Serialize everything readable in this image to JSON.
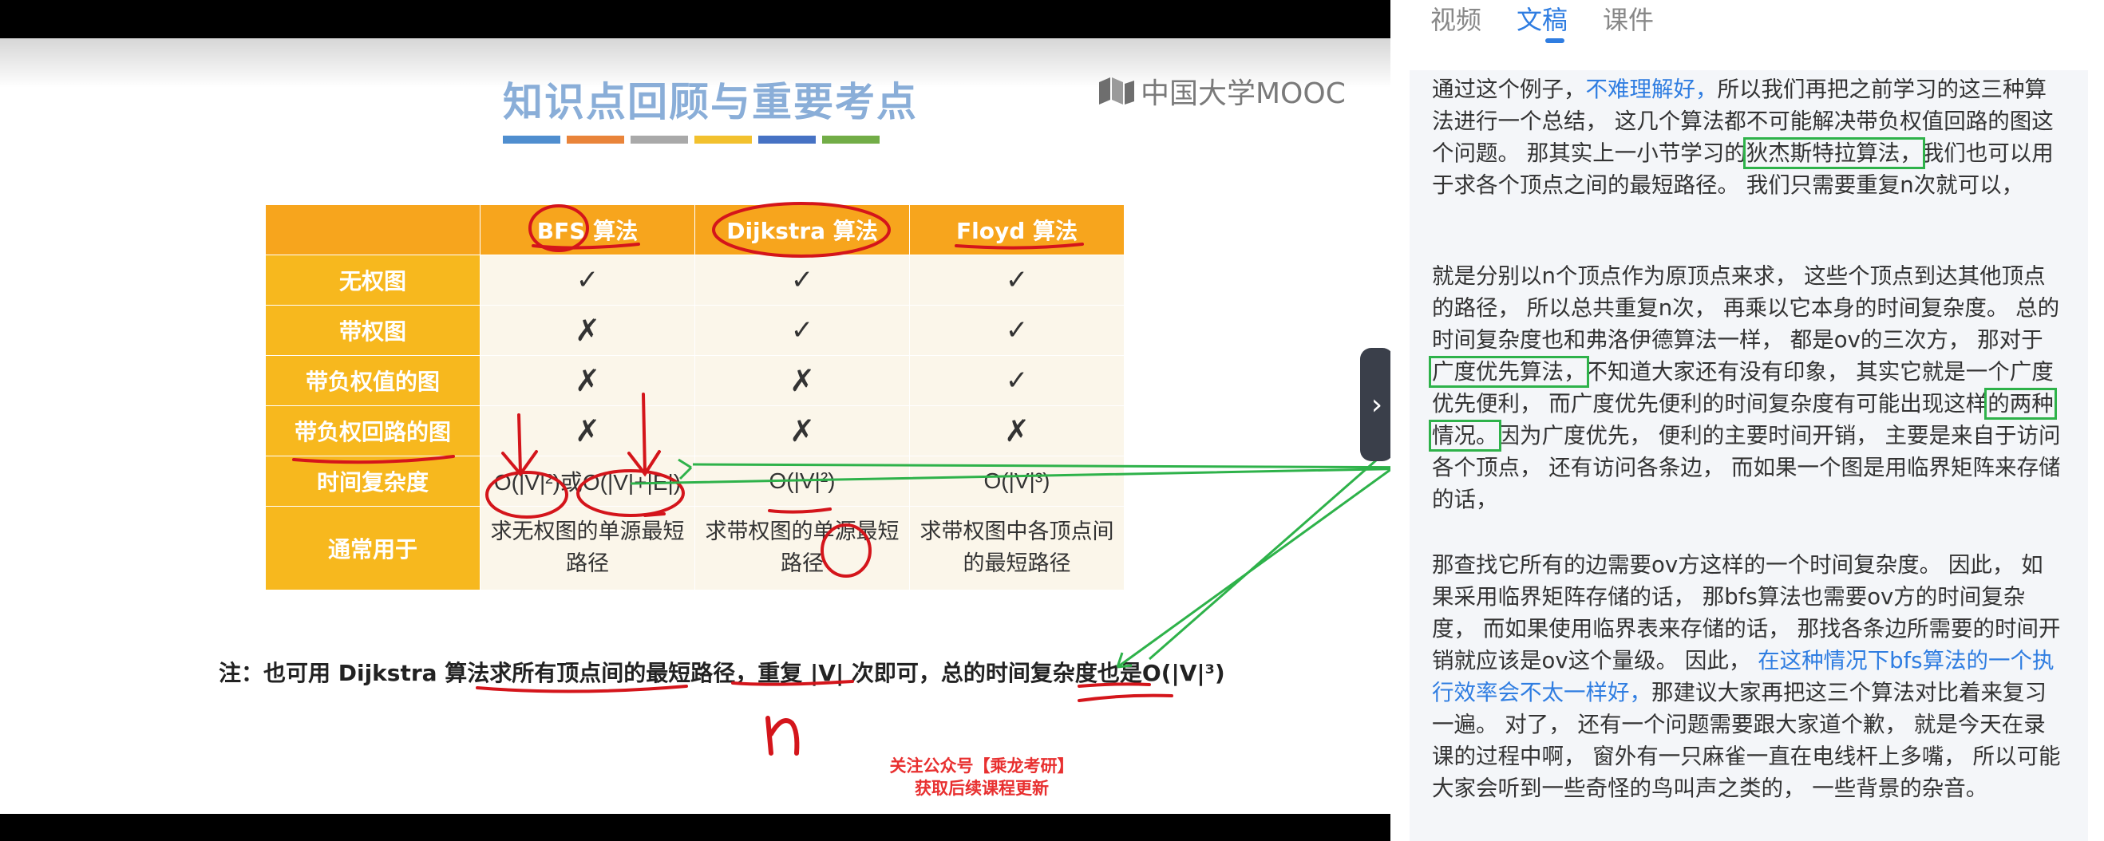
{
  "slide": {
    "title": "知识点回顾与重要考点",
    "logo_text": "中国大学MOOC",
    "color_bars": [
      "#4f8ecf",
      "#e9843a",
      "#a9a9a9",
      "#f2c12e",
      "#4672c4",
      "#72ad47"
    ],
    "table": {
      "headers": [
        "BFS 算法",
        "Dijkstra 算法",
        "Floyd 算法"
      ],
      "rows": [
        {
          "label": "无权图",
          "cells": [
            "✓",
            "✓",
            "✓"
          ]
        },
        {
          "label": "带权图",
          "cells": [
            "✗",
            "✓",
            "✓"
          ]
        },
        {
          "label": "带负权值的图",
          "cells": [
            "✗",
            "✗",
            "✓"
          ]
        },
        {
          "label": "带负权回路的图",
          "cells": [
            "✗",
            "✗",
            "✗"
          ]
        },
        {
          "label": "时间复杂度",
          "cells": [
            "O(|V|²)或O(|V|+|E|)",
            "O(|V|²)",
            "O(|V|³)"
          ]
        },
        {
          "label": "通常用于",
          "cells": [
            "求无权图的单源最短路径",
            "求带权图的单源最短路径",
            "求带权图中各顶点间的最短路径"
          ]
        }
      ]
    },
    "note": "注：也可用 Dijkstra 算法求所有顶点间的最短路径，重复 |V| 次即可，总的时间复杂度也是O(|V|³)",
    "handwritten_n": "n",
    "promo_line1": "关注公众号【乘龙考研】",
    "promo_line2": "获取后续课程更新"
  },
  "panel": {
    "tabs": [
      {
        "label": "视频",
        "active": false
      },
      {
        "label": "文稿",
        "active": true
      },
      {
        "label": "课件",
        "active": false
      }
    ],
    "collapse_icon": "chevron-right-icon",
    "paragraphs": [
      [
        {
          "text": "通过这个例子，",
          "style": "normal"
        },
        {
          "text": "不难理解好，",
          "style": "highlight"
        },
        {
          "text": "所以我们再把之前学习的这三种算法进行一个总结， 这几个算法都不可能解决带负权值回路的图这个问题。 那其实上一小节学习的",
          "style": "normal"
        },
        {
          "text": "狄杰斯特拉算法，",
          "style": "boxed"
        },
        {
          "text": "我们也可以用于求各个顶点之间的最短路径。 我们只需要重复n次就可以，",
          "style": "normal"
        }
      ],
      [
        {
          "text": "就是分别以n个顶点作为原顶点来求， 这些个顶点到达其他顶点的路径， 所以总共重复n次， 再乘以它本身的时间复杂度。 总的时间复杂度也和弗洛伊德算法一样， 都是ov的三次方， 那对于",
          "style": "normal"
        },
        {
          "text": "广度优先算法，",
          "style": "boxed"
        },
        {
          "text": "不知道大家还有没有印象， 其实它就是一个广度优先便利， 而广度优先便利的时间复杂度有可能出现这样",
          "style": "normal"
        },
        {
          "text": "的两种情况。",
          "style": "boxed"
        },
        {
          "text": "因为广度优先， 便利的主要时间开销， 主要是来自于访问各个顶点， 还有访问各条边， 而如果一个图是用临界矩阵来存储的话，",
          "style": "normal"
        }
      ],
      [
        {
          "text": "那查找它所有的边需要ov方这样的一个时间复杂度。 因此， 如果采用临界矩阵存储的话， 那bfs算法也需要ov方的时间复杂度， 而如果使用临界表来存储的话， 那找各条边所需要的时间开销就应该是ov这个量级。 因此， ",
          "style": "normal"
        },
        {
          "text": "在这种情况下bfs算法的一个执行效率会不太一样好，",
          "style": "highlight"
        },
        {
          "text": "那建议大家再把这三个算法对比着来复习一遍。 对了， 还有一个问题需要跟大家道个歉， 就是今天在录课的过程中啊， 窗外有一只麻雀一直在电线杆上多嘴， 所以可能大家会听到一些奇怪的鸟叫声之类的， 一些背景的杂音。",
          "style": "normal"
        }
      ]
    ]
  }
}
